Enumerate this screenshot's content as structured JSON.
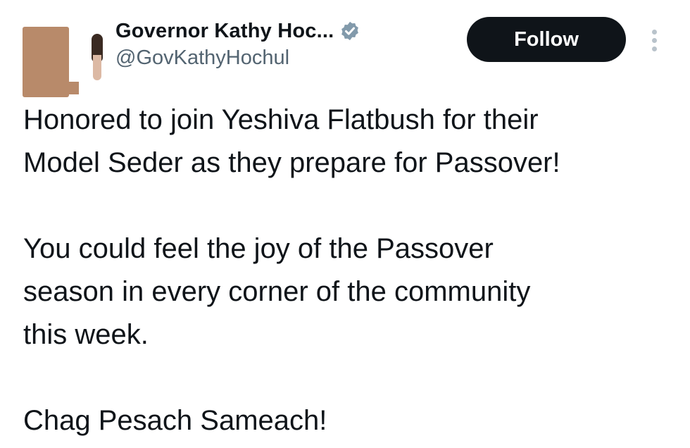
{
  "tweet": {
    "author": {
      "display_name": "Governor Kathy Hoc...",
      "handle": "@GovKathyHochul",
      "verified": true,
      "verified_color": "#829aab"
    },
    "actions": {
      "follow_label": "Follow",
      "more_icon": "more-vertical-icon"
    },
    "text": {
      "line1": "Honored to join Yeshiva Flatbush for their",
      "line2": "Model Seder as they prepare for Passover!",
      "line3": "You could feel the joy of the Passover",
      "line4": "season in every corner of the community",
      "line5": "this week.",
      "line6": "Chag Pesach Sameach!"
    }
  }
}
